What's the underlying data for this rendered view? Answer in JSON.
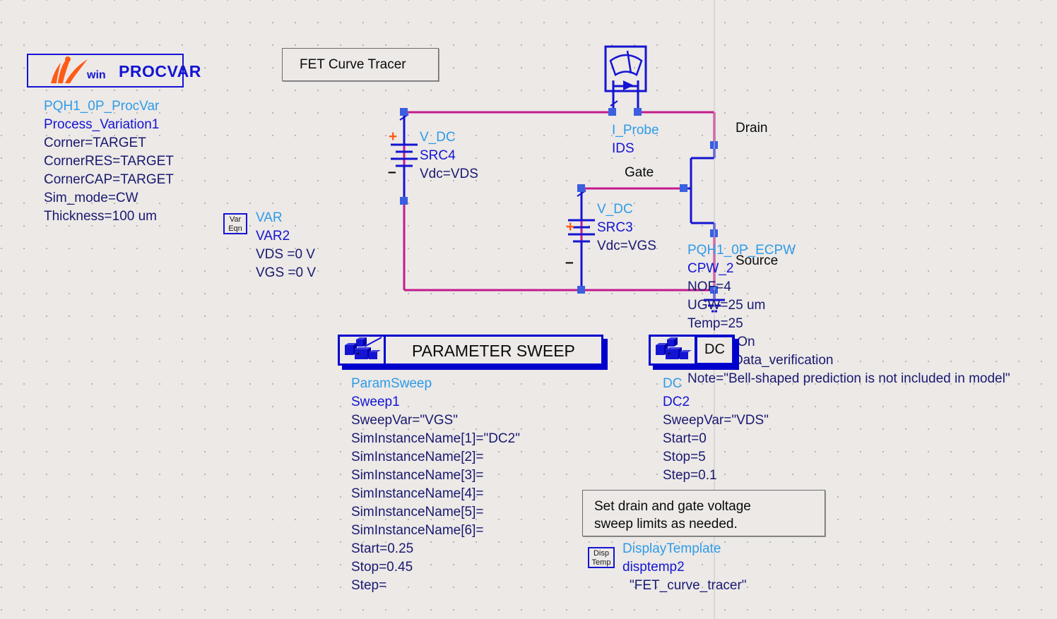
{
  "schematic": {
    "title_note": "FET Curve Tracer",
    "hint_note": "Set drain and gate voltage\nsweep limits as needed.",
    "node_labels": {
      "drain": "Drain",
      "gate": "Gate",
      "source": "Source"
    },
    "colors": {
      "background": "#ECE9E7",
      "wire": "#C31B8C",
      "component": "#1414D2",
      "instance_name": "#2F9BE8",
      "parameter_text": "#191970",
      "accent_orange": "#FF5A16",
      "pin": "#3A5FE0"
    }
  },
  "procvar": {
    "logo_iv": "IV",
    "logo_win": "win",
    "logo_title": "PROCVAR",
    "lines": [
      {
        "text": "PQH1_0P_ProcVar",
        "style": "cyan"
      },
      {
        "text": "Process_Variation1",
        "style": "blue"
      },
      {
        "text": "Corner=TARGET",
        "style": "navy"
      },
      {
        "text": "CornerRES=TARGET",
        "style": "navy"
      },
      {
        "text": "CornerCAP=TARGET",
        "style": "navy"
      },
      {
        "text": "Sim_mode=CW",
        "style": "navy"
      },
      {
        "text": "Thickness=100 um",
        "style": "navy"
      }
    ]
  },
  "var_eqn": {
    "icon_line1": "Var",
    "icon_line2": "Eqn",
    "lines": [
      {
        "text": "VAR",
        "style": "cyan"
      },
      {
        "text": "VAR2",
        "style": "blue"
      },
      {
        "text": "VDS =0 V",
        "style": "navy"
      },
      {
        "text": "VGS =0 V",
        "style": "navy"
      }
    ]
  },
  "src4": {
    "plus": "+",
    "minus": "–",
    "lines": [
      {
        "text": "V_DC",
        "style": "cyan"
      },
      {
        "text": "SRC4",
        "style": "blue"
      },
      {
        "text": "Vdc=VDS",
        "style": "navy"
      }
    ]
  },
  "src3": {
    "plus": "+",
    "minus": "–",
    "lines": [
      {
        "text": "V_DC",
        "style": "cyan"
      },
      {
        "text": "SRC3",
        "style": "blue"
      },
      {
        "text": "Vdc=VGS",
        "style": "navy"
      }
    ]
  },
  "iprobe": {
    "lines": [
      {
        "text": "I_Probe",
        "style": "cyan"
      },
      {
        "text": "IDS",
        "style": "blue"
      }
    ]
  },
  "fet": {
    "lines": [
      {
        "text": "PQH1_0P_ECPW",
        "style": "cyan"
      },
      {
        "text": "CPW_2",
        "style": "blue"
      },
      {
        "text": "NOF=4",
        "style": "navy"
      },
      {
        "text": "UGW=25 um",
        "style": "navy"
      },
      {
        "text": "Temp=25",
        "style": "navy"
      },
      {
        "text": "NOISE=On",
        "style": "navy"
      },
      {
        "text": "Status=Data_verification",
        "style": "navy"
      },
      {
        "text": "Note=\"Bell-shaped prediction is not included in model\"",
        "style": "navy"
      }
    ]
  },
  "param_sweep": {
    "banner_label": "PARAMETER SWEEP",
    "icon_name": "parameter-sweep-icon",
    "lines": [
      {
        "text": "ParamSweep",
        "style": "cyan"
      },
      {
        "text": "Sweep1",
        "style": "blue"
      },
      {
        "text": "SweepVar=\"VGS\"",
        "style": "navy"
      },
      {
        "text": "SimInstanceName[1]=\"DC2\"",
        "style": "navy"
      },
      {
        "text": "SimInstanceName[2]=",
        "style": "navy"
      },
      {
        "text": "SimInstanceName[3]=",
        "style": "navy"
      },
      {
        "text": "SimInstanceName[4]=",
        "style": "navy"
      },
      {
        "text": "SimInstanceName[5]=",
        "style": "navy"
      },
      {
        "text": "SimInstanceName[6]=",
        "style": "navy"
      },
      {
        "text": "Start=0.25",
        "style": "navy"
      },
      {
        "text": "Stop=0.45",
        "style": "navy"
      },
      {
        "text": "Step=",
        "style": "navy"
      }
    ]
  },
  "dc_sim": {
    "banner_label": "DC",
    "icon_name": "dc-simulation-icon",
    "lines": [
      {
        "text": "DC",
        "style": "cyan"
      },
      {
        "text": "DC2",
        "style": "blue"
      },
      {
        "text": "SweepVar=\"VDS\"",
        "style": "navy"
      },
      {
        "text": "Start=0",
        "style": "navy"
      },
      {
        "text": "Stop=5",
        "style": "navy"
      },
      {
        "text": "Step=0.1",
        "style": "navy"
      }
    ]
  },
  "display_template": {
    "icon_line1": "Disp",
    "icon_line2": "Temp",
    "lines": [
      {
        "text": "DisplayTemplate",
        "style": "cyan"
      },
      {
        "text": "disptemp2",
        "style": "blue"
      },
      {
        "text": "\"FET_curve_tracer\"",
        "style": "navy"
      }
    ]
  }
}
